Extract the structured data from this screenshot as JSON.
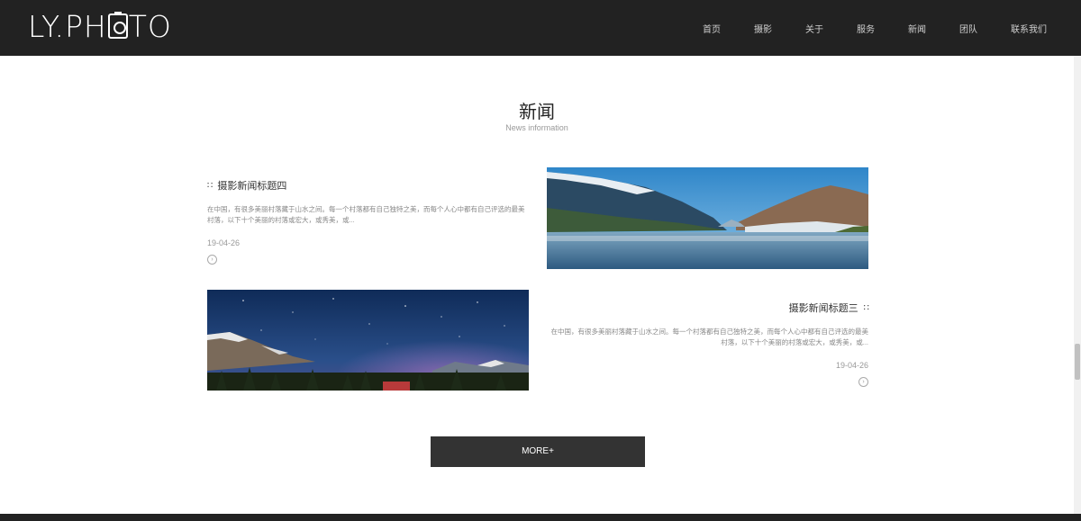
{
  "header": {
    "logo_left": "LY.PH",
    "logo_right": "TO",
    "nav": [
      "首页",
      "摄影",
      "关于",
      "服务",
      "新闻",
      "团队",
      "联系我们"
    ]
  },
  "section": {
    "title": "新闻",
    "subtitle": "News information"
  },
  "news": [
    {
      "title": "摄影新闻标题四",
      "desc": "在中国，有很多美丽村落藏于山水之间。每一个村落都有自己独特之美，而每个人心中都有自己评选的最美村落，以下十个美丽的村落或宏大，或秀美，或...",
      "date": "19-04-26",
      "image": "lake-mountains-photo"
    },
    {
      "title": "摄影新闻标题三",
      "desc": "在中国，有很多美丽村落藏于山水之间。每一个村落都有自己独特之美，而每个人心中都有自己评选的最美村落，以下十个美丽的村落或宏大，或秀美，或...",
      "date": "19-04-26",
      "image": "night-sky-mountains-photo"
    }
  ],
  "more_label": "MORE+",
  "colors": {
    "header_bg": "#222222",
    "button_bg": "#333333"
  }
}
